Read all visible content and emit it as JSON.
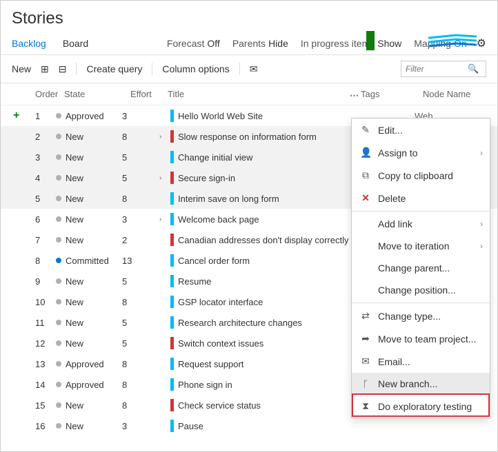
{
  "header": {
    "title": "Stories"
  },
  "tabs": {
    "backlog": "Backlog",
    "board": "Board"
  },
  "options": {
    "forecast_k": "Forecast",
    "forecast_v": "Off",
    "parents_k": "Parents",
    "parents_v": "Hide",
    "inprogress_k": "In progress items",
    "inprogress_v": "Show",
    "mapping_k": "Mapping",
    "mapping_v": "On"
  },
  "toolbar": {
    "new": "New",
    "create_query": "Create query",
    "column_options": "Column options",
    "filter_placeholder": "Filter"
  },
  "columns": {
    "order": "Order",
    "state": "State",
    "effort": "Effort",
    "title": "Title",
    "tags": "Tags",
    "node": "Node Name"
  },
  "rows": [
    {
      "order": "1",
      "state": "Approved",
      "effort": "3",
      "title": "Hello World Web Site",
      "stripe": "blue",
      "chev": false,
      "band": false,
      "node": "Web",
      "first": true
    },
    {
      "order": "2",
      "state": "New",
      "effort": "8",
      "title": "Slow response on information form",
      "stripe": "red",
      "chev": true,
      "band": true
    },
    {
      "order": "3",
      "state": "New",
      "effort": "5",
      "title": "Change initial view",
      "stripe": "blue",
      "chev": false,
      "band": true
    },
    {
      "order": "4",
      "state": "New",
      "effort": "5",
      "title": "Secure sign-in",
      "stripe": "red",
      "chev": true,
      "band": true
    },
    {
      "order": "5",
      "state": "New",
      "effort": "8",
      "title": "Interim save on long form",
      "stripe": "blue",
      "chev": false,
      "band": true
    },
    {
      "order": "6",
      "state": "New",
      "effort": "3",
      "title": "Welcome back page",
      "stripe": "blue",
      "chev": true,
      "band": false
    },
    {
      "order": "7",
      "state": "New",
      "effort": "2",
      "title": "Canadian addresses don't display correctly",
      "stripe": "red",
      "chev": false,
      "band": false
    },
    {
      "order": "8",
      "state": "Committed",
      "effort": "13",
      "title": "Cancel order form",
      "stripe": "blue",
      "chev": false,
      "band": false,
      "dot": "blue"
    },
    {
      "order": "9",
      "state": "New",
      "effort": "5",
      "title": "Resume",
      "stripe": "blue",
      "chev": false,
      "band": false
    },
    {
      "order": "10",
      "state": "New",
      "effort": "8",
      "title": "GSP locator interface",
      "stripe": "blue",
      "chev": false,
      "band": false
    },
    {
      "order": "11",
      "state": "New",
      "effort": "5",
      "title": "Research architecture changes",
      "stripe": "blue",
      "chev": false,
      "band": false
    },
    {
      "order": "12",
      "state": "New",
      "effort": "5",
      "title": "Switch context issues",
      "stripe": "red",
      "chev": false,
      "band": false
    },
    {
      "order": "13",
      "state": "Approved",
      "effort": "8",
      "title": "Request support",
      "stripe": "blue",
      "chev": false,
      "band": false
    },
    {
      "order": "14",
      "state": "Approved",
      "effort": "8",
      "title": "Phone sign in",
      "stripe": "blue",
      "chev": false,
      "band": false
    },
    {
      "order": "15",
      "state": "New",
      "effort": "8",
      "title": "Check service status",
      "stripe": "red",
      "chev": false,
      "band": false
    },
    {
      "order": "16",
      "state": "New",
      "effort": "3",
      "title": "Pause",
      "stripe": "blue",
      "chev": false,
      "band": false
    }
  ],
  "menu": [
    {
      "ico": "✎",
      "label": "Edit..."
    },
    {
      "ico": "👤",
      "label": "Assign to",
      "sub": true
    },
    {
      "ico": "⧉",
      "label": "Copy to clipboard"
    },
    {
      "ico": "✕",
      "label": "Delete",
      "red": true
    },
    {
      "sep": true
    },
    {
      "ico": "",
      "label": "Add link",
      "sub": true
    },
    {
      "ico": "",
      "label": "Move to iteration",
      "sub": true
    },
    {
      "ico": "",
      "label": "Change parent..."
    },
    {
      "ico": "",
      "label": "Change position..."
    },
    {
      "sep": true
    },
    {
      "ico": "⇄",
      "label": "Change type..."
    },
    {
      "ico": "➦",
      "label": "Move to team project..."
    },
    {
      "ico": "✉",
      "label": "Email..."
    },
    {
      "ico": "ᚴ",
      "label": "New branch...",
      "hover": true
    },
    {
      "ico": "⧗",
      "label": "Do exploratory testing"
    }
  ]
}
